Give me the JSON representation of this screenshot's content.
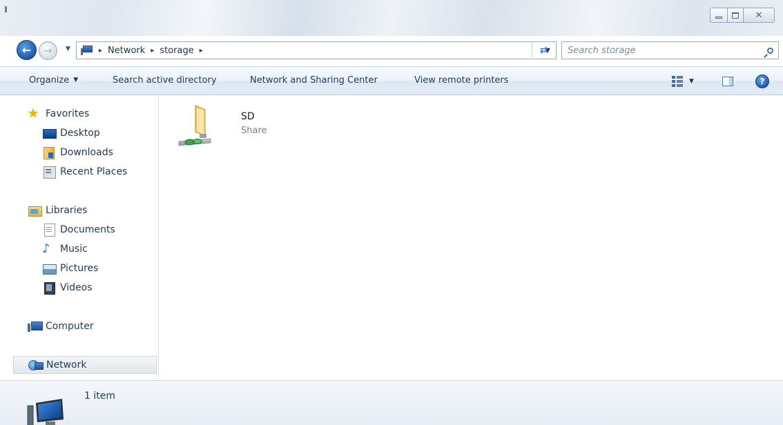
{
  "window": {
    "caption_buttons": {
      "minimize": "minimize",
      "maximize": "maximize",
      "close": "✕"
    }
  },
  "navigation": {
    "back_icon": "back-arrow-icon",
    "forward_icon": "forward-arrow-icon",
    "address": {
      "crumbs": [
        "Network",
        "storage"
      ],
      "separator": "▸"
    },
    "refresh_icon": "refresh-icon",
    "search": {
      "placeholder": "Search storage"
    }
  },
  "command_bar": {
    "organize": "Organize",
    "search_active_directory": "Search active directory",
    "network_sharing_center": "Network and Sharing Center",
    "view_remote_printers": "View remote printers",
    "help": "?"
  },
  "nav_pane": {
    "favorites": {
      "label": "Favorites",
      "items": [
        "Desktop",
        "Downloads",
        "Recent Places"
      ]
    },
    "libraries": {
      "label": "Libraries",
      "items": [
        "Documents",
        "Music",
        "Pictures",
        "Videos"
      ]
    },
    "computer": {
      "label": "Computer"
    },
    "network": {
      "label": "Network",
      "selected": true
    }
  },
  "content": {
    "items": [
      {
        "name": "SD",
        "type": "Share",
        "icon": "network-share-folder-icon"
      }
    ]
  },
  "details": {
    "count": "1 item"
  },
  "colors": {
    "accent": "#1e3950",
    "command_bar": "#e3ecf6",
    "selection": "#e2e7ec"
  }
}
